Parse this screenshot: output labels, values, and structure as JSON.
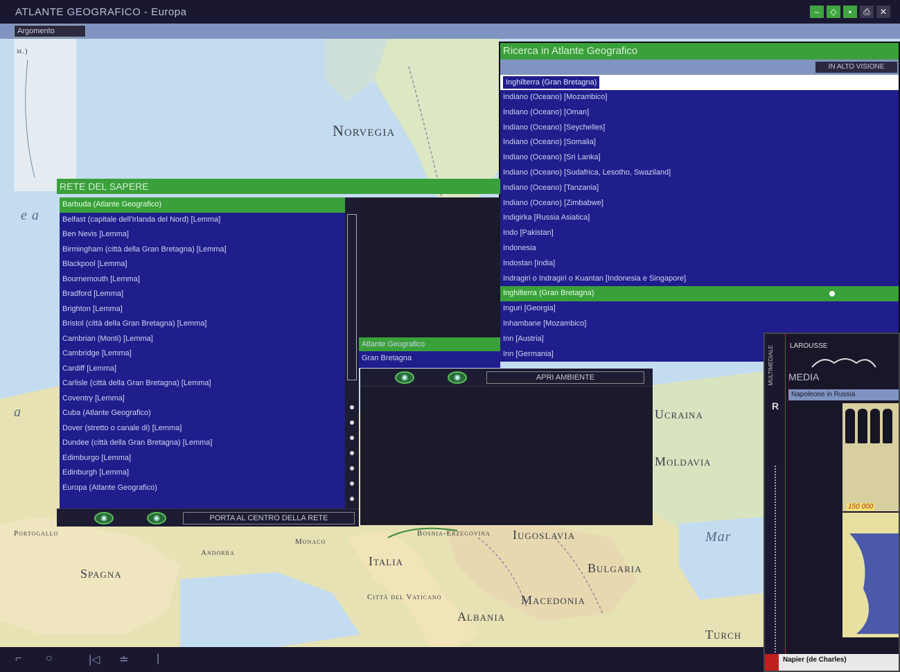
{
  "window": {
    "title": "ATLANTE GEOGRAFICO - Europa",
    "toolbar_button": "Argomento"
  },
  "map": {
    "labels": {
      "norvegia": "Norvegia",
      "ucraina": "Ucraina",
      "moldavia": "Moldavia",
      "spagna": "Spagna",
      "italia": "Italia",
      "bulgaria": "Bulgaria",
      "jugoslavia": "Iugoslavia",
      "macedonia": "Macedonia",
      "albania": "Albania",
      "bosnia": "Bosnia-Erzegovina",
      "andorra": "Andorra",
      "monaco": "Monaco",
      "vaticano": "Città del Vaticano",
      "portogallo": "Portogallo",
      "turchia": "Turch",
      "mar": "Mar",
      "frag_m": "m.)",
      "frag_e": "e a",
      "frag_a": "a"
    }
  },
  "rete": {
    "title": "RETE DEL SAPERE",
    "items": [
      "Barbuda (Atlante Geografico)",
      "Belfast (capitale dell'Irlanda del Nord) [Lemma]",
      "Ben Nevis [Lemma]",
      "Birmingham (città della Gran Bretagna) [Lemma]",
      "Blackpool [Lemma]",
      "Bournemouth [Lemma]",
      "Bradford [Lemma]",
      "Brighton [Lemma]",
      "Bristol (città della Gran Bretagna) [Lemma]",
      "Cambrian (Monti) [Lemma]",
      "Cambridge [Lemma]",
      "Cardiff [Lemma]",
      "Carlisle (città della Gran Bretagna) [Lemma]",
      "Coventry [Lemma]",
      "Cuba (Atlante Geografico)",
      "Dover (stretto o canale di) [Lemma]",
      "Dundee (città della Gran Bretagna) [Lemma]",
      "Edimburgo [Lemma]",
      "Edinburgh [Lemma]",
      "Europa (Atlante Geografico)"
    ],
    "sub_items": [
      "Atlante Geografico",
      "Gran Bretagna"
    ],
    "center_button": "PORTA AL CENTRO DELLA RETE",
    "open_button": "APRI AMBIENTE",
    "eye_label": "◉"
  },
  "ricerca": {
    "title": "Ricerca in Atlante Geografico",
    "all_button": "IN ALTO VISIONE",
    "search_value": "Inghilterra (Gran Bretagna)",
    "items": [
      "Indiano (Oceano) [Mozambico]",
      "Indiano (Oceano) [Oman]",
      "Indiano (Oceano) [Seychelles]",
      "Indiano (Oceano) [Somalia]",
      "Indiano (Oceano) [Sri Lanka]",
      "Indiano (Oceano) [Sudafrica, Lesotho, Swaziland]",
      "Indiano (Oceano) [Tanzania]",
      "Indiano (Oceano) [Zimbabwe]",
      "Indigirka [Russia Asiatica]",
      "Indo [Pakistan]",
      "Indonesia",
      "Indostan [India]",
      "Indragiri o Indragiri o Kuantan [Indonesia e Singapore]",
      "Inghilterra (Gran Bretagna)",
      "Inguri [Georgia]",
      "Inhambane [Mozambico]",
      "Inn [Austria]",
      "Inn [Germania]"
    ],
    "selected_index": 13
  },
  "media": {
    "brand": "LAROUSSE",
    "side_text": "MULTIMEDIALE",
    "title": "MEDIA",
    "bar_label": "Napoleone in Russia",
    "side_letter": "R",
    "photo_label": "150 000",
    "caption": "Napier (de Charles)"
  },
  "bottombar": {
    "icons": [
      "⌐",
      "○",
      "|◁",
      "≐",
      "|"
    ]
  },
  "colors": {
    "accent_green": "#3aa03a",
    "list_blue": "#201d8c",
    "bar_blue": "#7f94c0",
    "panel_dark": "#1d1c33"
  }
}
